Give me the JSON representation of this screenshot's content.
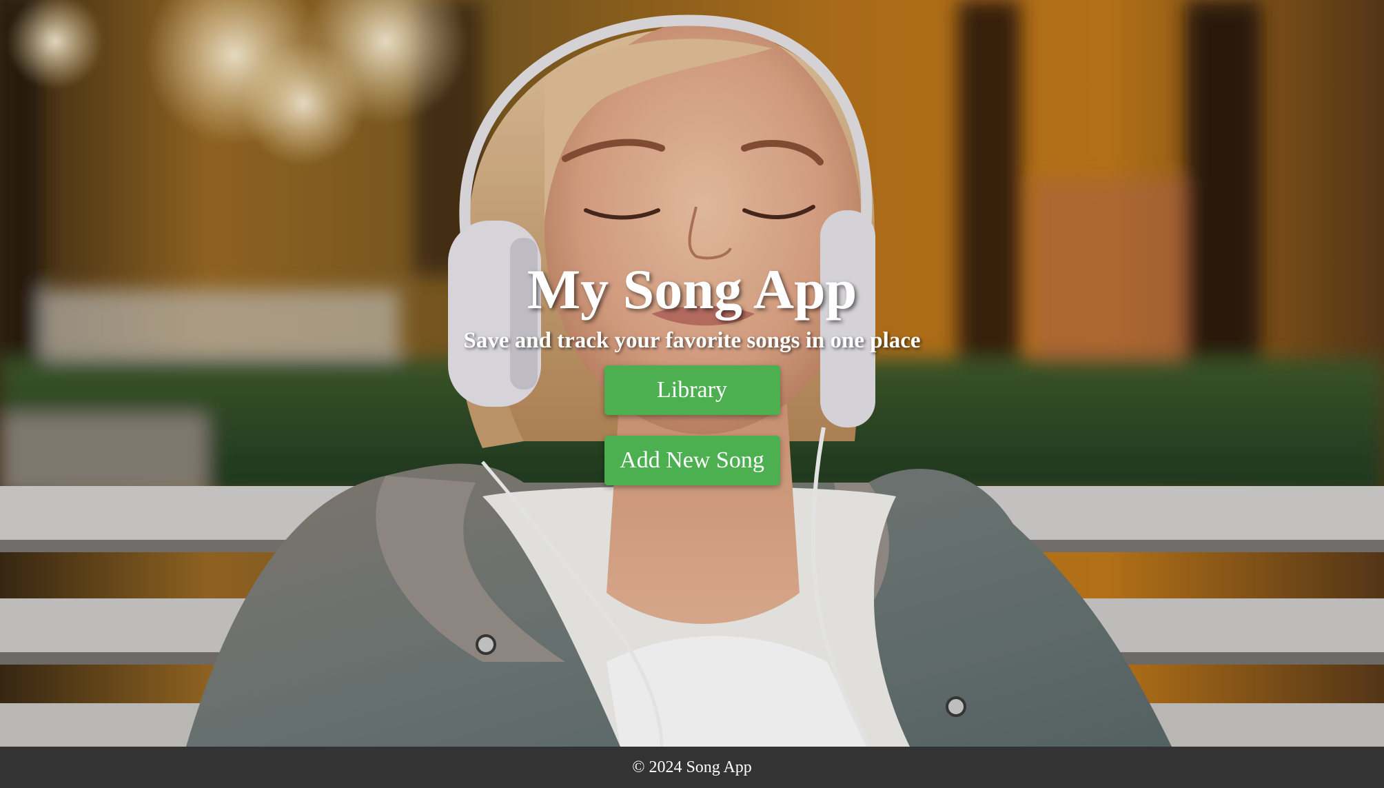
{
  "hero": {
    "title": "My Song App",
    "subtitle": "Save and track your favorite songs in one place",
    "image": "woman-with-headphones-on-park-bench"
  },
  "actions": {
    "library_label": "Library",
    "add_song_label": "Add New Song"
  },
  "footer": {
    "text": "© 2024 Song App"
  },
  "colors": {
    "button": "#4caf50",
    "footer": "#333333",
    "text": "#ffffff"
  }
}
